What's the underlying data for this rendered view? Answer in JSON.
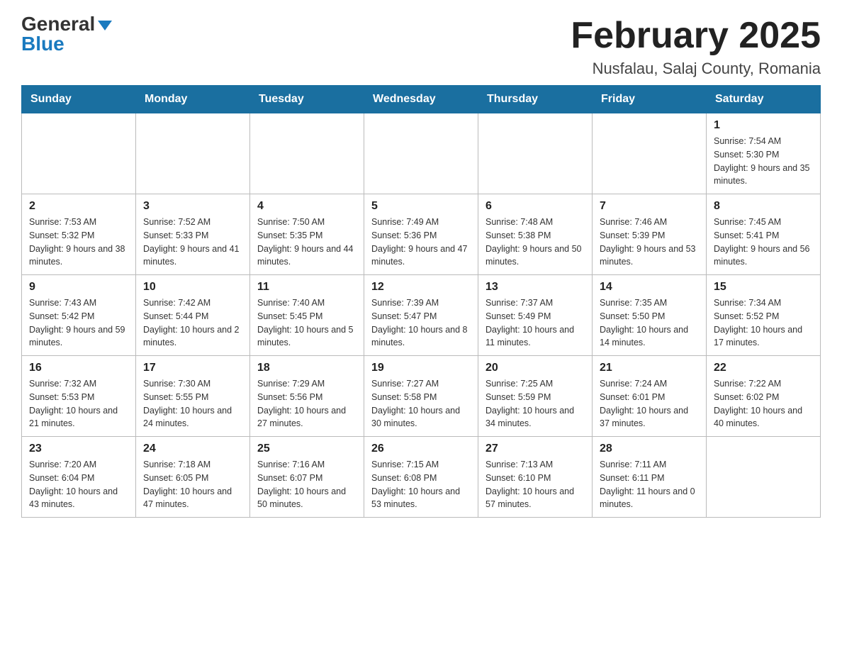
{
  "header": {
    "logo_line1": "General",
    "logo_line2": "Blue",
    "month_title": "February 2025",
    "location": "Nusfalau, Salaj County, Romania"
  },
  "weekdays": [
    "Sunday",
    "Monday",
    "Tuesday",
    "Wednesday",
    "Thursday",
    "Friday",
    "Saturday"
  ],
  "weeks": [
    [
      {
        "day": "",
        "info": ""
      },
      {
        "day": "",
        "info": ""
      },
      {
        "day": "",
        "info": ""
      },
      {
        "day": "",
        "info": ""
      },
      {
        "day": "",
        "info": ""
      },
      {
        "day": "",
        "info": ""
      },
      {
        "day": "1",
        "info": "Sunrise: 7:54 AM\nSunset: 5:30 PM\nDaylight: 9 hours and 35 minutes."
      }
    ],
    [
      {
        "day": "2",
        "info": "Sunrise: 7:53 AM\nSunset: 5:32 PM\nDaylight: 9 hours and 38 minutes."
      },
      {
        "day": "3",
        "info": "Sunrise: 7:52 AM\nSunset: 5:33 PM\nDaylight: 9 hours and 41 minutes."
      },
      {
        "day": "4",
        "info": "Sunrise: 7:50 AM\nSunset: 5:35 PM\nDaylight: 9 hours and 44 minutes."
      },
      {
        "day": "5",
        "info": "Sunrise: 7:49 AM\nSunset: 5:36 PM\nDaylight: 9 hours and 47 minutes."
      },
      {
        "day": "6",
        "info": "Sunrise: 7:48 AM\nSunset: 5:38 PM\nDaylight: 9 hours and 50 minutes."
      },
      {
        "day": "7",
        "info": "Sunrise: 7:46 AM\nSunset: 5:39 PM\nDaylight: 9 hours and 53 minutes."
      },
      {
        "day": "8",
        "info": "Sunrise: 7:45 AM\nSunset: 5:41 PM\nDaylight: 9 hours and 56 minutes."
      }
    ],
    [
      {
        "day": "9",
        "info": "Sunrise: 7:43 AM\nSunset: 5:42 PM\nDaylight: 9 hours and 59 minutes."
      },
      {
        "day": "10",
        "info": "Sunrise: 7:42 AM\nSunset: 5:44 PM\nDaylight: 10 hours and 2 minutes."
      },
      {
        "day": "11",
        "info": "Sunrise: 7:40 AM\nSunset: 5:45 PM\nDaylight: 10 hours and 5 minutes."
      },
      {
        "day": "12",
        "info": "Sunrise: 7:39 AM\nSunset: 5:47 PM\nDaylight: 10 hours and 8 minutes."
      },
      {
        "day": "13",
        "info": "Sunrise: 7:37 AM\nSunset: 5:49 PM\nDaylight: 10 hours and 11 minutes."
      },
      {
        "day": "14",
        "info": "Sunrise: 7:35 AM\nSunset: 5:50 PM\nDaylight: 10 hours and 14 minutes."
      },
      {
        "day": "15",
        "info": "Sunrise: 7:34 AM\nSunset: 5:52 PM\nDaylight: 10 hours and 17 minutes."
      }
    ],
    [
      {
        "day": "16",
        "info": "Sunrise: 7:32 AM\nSunset: 5:53 PM\nDaylight: 10 hours and 21 minutes."
      },
      {
        "day": "17",
        "info": "Sunrise: 7:30 AM\nSunset: 5:55 PM\nDaylight: 10 hours and 24 minutes."
      },
      {
        "day": "18",
        "info": "Sunrise: 7:29 AM\nSunset: 5:56 PM\nDaylight: 10 hours and 27 minutes."
      },
      {
        "day": "19",
        "info": "Sunrise: 7:27 AM\nSunset: 5:58 PM\nDaylight: 10 hours and 30 minutes."
      },
      {
        "day": "20",
        "info": "Sunrise: 7:25 AM\nSunset: 5:59 PM\nDaylight: 10 hours and 34 minutes."
      },
      {
        "day": "21",
        "info": "Sunrise: 7:24 AM\nSunset: 6:01 PM\nDaylight: 10 hours and 37 minutes."
      },
      {
        "day": "22",
        "info": "Sunrise: 7:22 AM\nSunset: 6:02 PM\nDaylight: 10 hours and 40 minutes."
      }
    ],
    [
      {
        "day": "23",
        "info": "Sunrise: 7:20 AM\nSunset: 6:04 PM\nDaylight: 10 hours and 43 minutes."
      },
      {
        "day": "24",
        "info": "Sunrise: 7:18 AM\nSunset: 6:05 PM\nDaylight: 10 hours and 47 minutes."
      },
      {
        "day": "25",
        "info": "Sunrise: 7:16 AM\nSunset: 6:07 PM\nDaylight: 10 hours and 50 minutes."
      },
      {
        "day": "26",
        "info": "Sunrise: 7:15 AM\nSunset: 6:08 PM\nDaylight: 10 hours and 53 minutes."
      },
      {
        "day": "27",
        "info": "Sunrise: 7:13 AM\nSunset: 6:10 PM\nDaylight: 10 hours and 57 minutes."
      },
      {
        "day": "28",
        "info": "Sunrise: 7:11 AM\nSunset: 6:11 PM\nDaylight: 11 hours and 0 minutes."
      },
      {
        "day": "",
        "info": ""
      }
    ]
  ]
}
